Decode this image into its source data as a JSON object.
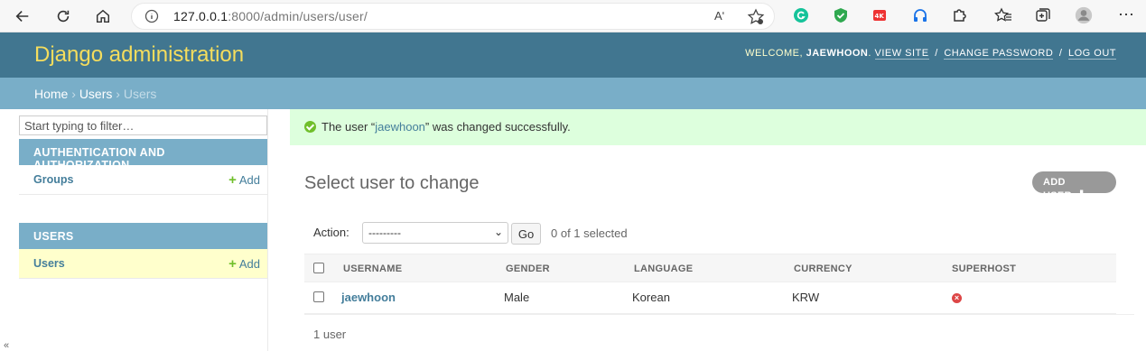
{
  "browser": {
    "url_host": "127.0.0.1",
    "url_rest": ":8000/admin/users/user/",
    "read_aloud": "Aʹ",
    "more": "⋯"
  },
  "header": {
    "brand": "Django administration",
    "welcome": "WELCOME,",
    "username": "JAEWHOON",
    "view_site": "VIEW SITE",
    "change_password": "CHANGE PASSWORD",
    "log_out": "LOG OUT",
    "sep": "/"
  },
  "breadcrumbs": {
    "home": "Home",
    "app": "Users",
    "current": "Users",
    "sep": "›"
  },
  "sidebar": {
    "filter_placeholder": "Start typing to filter…",
    "modules": [
      {
        "caption": "AUTHENTICATION AND AUTHORIZATION",
        "rows": [
          {
            "name": "Groups",
            "add": "Add"
          }
        ]
      },
      {
        "caption": "USERS",
        "rows": [
          {
            "name": "Users",
            "add": "Add"
          }
        ]
      }
    ],
    "collapse": "«"
  },
  "message": {
    "prefix": "The user “",
    "link": "jaewhoon",
    "suffix": "” was changed successfully."
  },
  "main": {
    "title": "Select user to change",
    "add_button": "ADD USER",
    "add_plus": "✚",
    "action_label": "Action:",
    "action_value": "---------",
    "go": "Go",
    "selected": "0 of 1 selected",
    "columns": [
      "USERNAME",
      "GENDER",
      "LANGUAGE",
      "CURRENCY",
      "SUPERHOST"
    ],
    "rows": [
      {
        "username": "jaewhoon",
        "gender": "Male",
        "language": "Korean",
        "currency": "KRW",
        "superhost": "×"
      }
    ],
    "paginator": "1 user"
  },
  "colors": {
    "header_bg": "#417690",
    "brand": "#f5dd5d",
    "breadcrumb_bg": "#79aec8",
    "success_bg": "#ddffdd",
    "link": "#447e9b"
  }
}
